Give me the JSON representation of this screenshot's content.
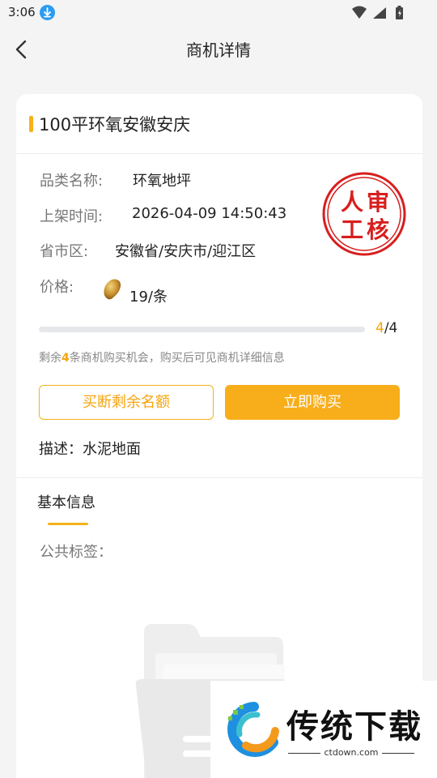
{
  "status_bar": {
    "time": "3:06"
  },
  "nav": {
    "title": "商机详情"
  },
  "card": {
    "title": "100平环氧安徽安庆",
    "category": {
      "label": "品类名称:",
      "value": "环氧地坪"
    },
    "listed_time": {
      "label": "上架时间:",
      "value": "2026-04-09 14:50:43"
    },
    "region": {
      "label": "省市区:",
      "value": "安徽省/安庆市/迎江区"
    },
    "price": {
      "label": "价格:",
      "value": "19/条"
    },
    "stamp_text": "人审工核",
    "progress": {
      "current": "4",
      "total": "/4",
      "fraction": 1.0
    },
    "remain_note": {
      "prefix": "剩余",
      "count": "4",
      "suffix": "条商机购买机会，购买后可见商机详细信息"
    },
    "buttons": {
      "buyout": "买断剩余名额",
      "buy_now": "立即购买"
    },
    "description": "描述：水泥地面",
    "tab_basic": "基本信息",
    "public_tags": "公共标签："
  },
  "watermark": {
    "brand": "传统下载",
    "url": "ctdown.com"
  },
  "colors": {
    "accent": "#f5b21b",
    "accent_text": "#f5a40d",
    "stamp_red": "#d81e1e"
  }
}
